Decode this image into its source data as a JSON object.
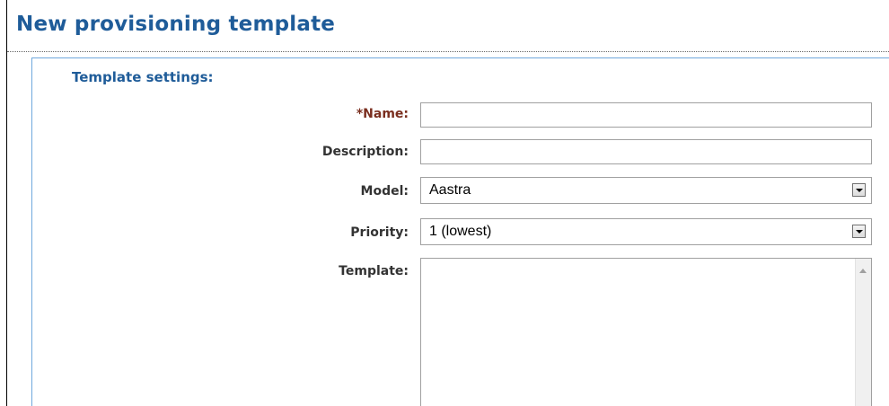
{
  "page": {
    "title": "New provisioning template"
  },
  "template_settings": {
    "section_title": "Template settings:",
    "name": {
      "label": "*Name:",
      "value": ""
    },
    "description": {
      "label": "Description:",
      "value": ""
    },
    "model": {
      "label": "Model:",
      "selected": "Aastra"
    },
    "priority": {
      "label": "Priority:",
      "selected": "1 (lowest)"
    },
    "template": {
      "label": "Template:",
      "value": ""
    }
  },
  "colors": {
    "title": "#1f5c99",
    "panel_border": "#6fa8dc",
    "required_label": "#7a2e1e",
    "label": "#333333"
  },
  "icons": {
    "select_arrow": "chevron-down-icon",
    "scroll_up": "scroll-up-arrow-icon"
  }
}
